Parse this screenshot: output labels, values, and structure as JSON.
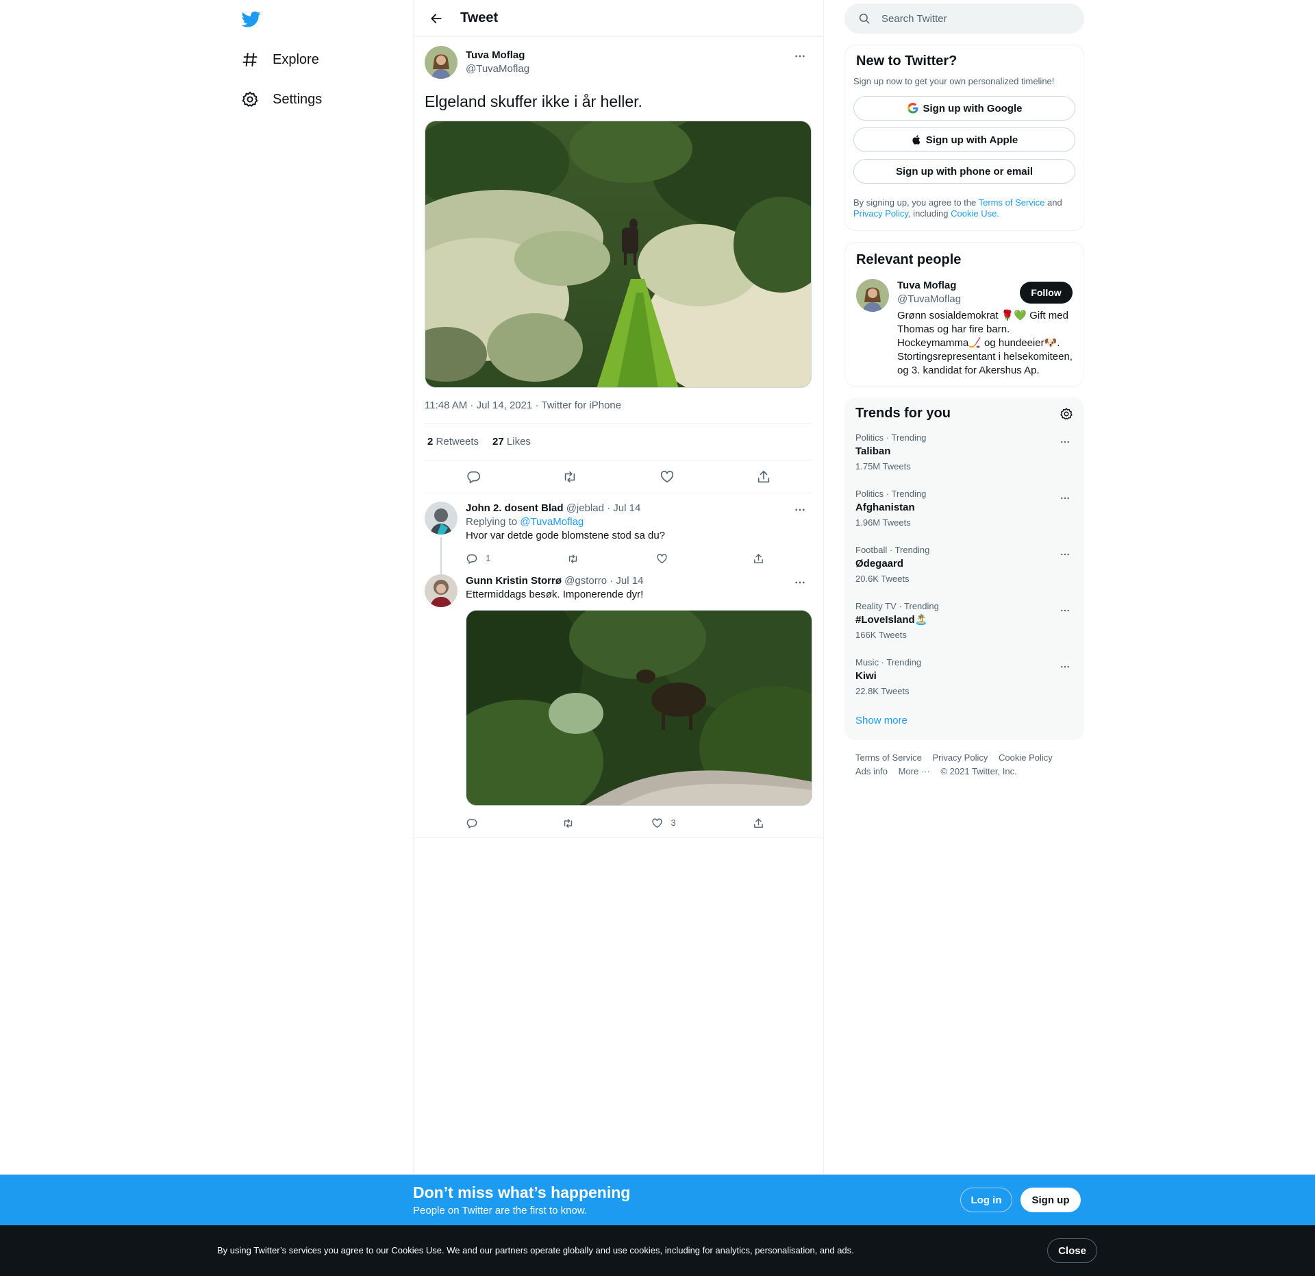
{
  "nav": {
    "items": [
      {
        "label": "Explore",
        "icon": "hashtag-icon"
      },
      {
        "label": "Settings",
        "icon": "gear-icon"
      }
    ]
  },
  "header": {
    "title": "Tweet"
  },
  "tweet": {
    "display_name": "Tuva Moflag",
    "username": "@TuvaMoflag",
    "text": "Elgeland skuffer ikke i år heller.",
    "meta": "11:48 AM · Jul 14, 2021 · Twitter for iPhone",
    "retweets_count": "2",
    "retweets_label": "Retweets",
    "likes_count": "27",
    "likes_label": "Likes"
  },
  "replies": [
    {
      "display_name": "John 2. dosent Blad",
      "username": "@jeblad",
      "date": "· Jul 14",
      "replying_prefix": "Replying to ",
      "replying_to": "@TuvaMoflag",
      "text": "Hvor var detde gode blomstene stod sa du?",
      "reply_count": "1",
      "like_count": ""
    },
    {
      "display_name": "Gunn Kristin Storrø",
      "username": "@gstorro",
      "date": "· Jul 14",
      "text": "Ettermiddags besøk. Imponerende dyr!",
      "reply_count": "",
      "like_count": "3"
    }
  ],
  "search": {
    "placeholder": "Search Twitter"
  },
  "signup_card": {
    "title": "New to Twitter?",
    "subtitle": "Sign up now to get your own personalized timeline!",
    "google_label": "Sign up with Google",
    "apple_label": "Sign up with Apple",
    "phone_label": "Sign up with phone or email",
    "legal_prefix": "By signing up, you agree to the ",
    "tos": "Terms of Service",
    "and": " and ",
    "privacy": "Privacy Policy",
    "including": ", including ",
    "cookie": "Cookie Use."
  },
  "relevant": {
    "title": "Relevant people",
    "display_name": "Tuva Moflag",
    "username": "@TuvaMoflag",
    "follow_label": "Follow",
    "bio": "Grønn sosialdemokrat 🌹💚 Gift med Thomas og har fire barn. Hockeymamma🏒 og hundeeier🐶. Stortingsrepresentant i helsekomiteen, og 3. kandidat for Akershus Ap."
  },
  "trends": {
    "title": "Trends for you",
    "items": [
      {
        "context": "Politics · Trending",
        "name": "Taliban",
        "count": "1.75M Tweets"
      },
      {
        "context": "Politics · Trending",
        "name": "Afghanistan",
        "count": "1.96M Tweets"
      },
      {
        "context": "Football · Trending",
        "name": "Ødegaard",
        "count": "20.6K Tweets"
      },
      {
        "context": "Reality TV · Trending",
        "name": "#LoveIsland🏝️",
        "count": "166K Tweets"
      },
      {
        "context": "Music · Trending",
        "name": "Kiwi",
        "count": "22.8K Tweets"
      }
    ],
    "show_more": "Show more"
  },
  "footer": {
    "links": [
      "Terms of Service",
      "Privacy Policy",
      "Cookie Policy",
      "Ads info",
      "More ···"
    ],
    "copyright": "© 2021 Twitter, Inc."
  },
  "bluebar": {
    "title": "Don’t miss what’s happening",
    "subtitle": "People on Twitter are the first to know.",
    "login": "Log in",
    "signup": "Sign up"
  },
  "cookiebar": {
    "text": "By using Twitter’s services you agree to our Cookies Use. We and our partners operate globally and use cookies, including for analytics, personalisation, and ads.",
    "close": "Close"
  },
  "colors": {
    "accent": "#1d9bf0",
    "dark": "#0f1419",
    "muted": "#536471"
  }
}
